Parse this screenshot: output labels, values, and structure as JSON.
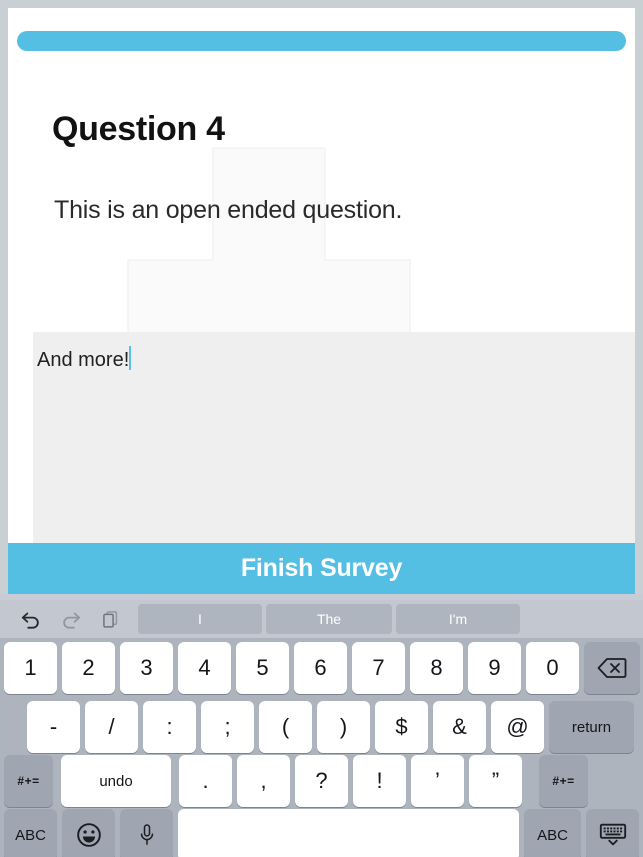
{
  "survey": {
    "progress": {
      "percent": 100,
      "fill_color": "#55bfe3",
      "icon": "progress-bar"
    },
    "question_title": "Question 4",
    "question_text": "This is an open ended question.",
    "answer_value": "And more!",
    "answer_placeholder": "",
    "finish_label": "Finish Survey",
    "finish_color": "#55bfe3"
  },
  "keyboard": {
    "toolbar": {
      "icons": [
        {
          "name": "undo-icon",
          "label": "undo"
        },
        {
          "name": "redo-icon",
          "label": "redo"
        },
        {
          "name": "paste-icon",
          "label": "paste"
        }
      ],
      "suggestions": [
        "I",
        "The",
        "I'm"
      ]
    },
    "rows": {
      "numbers": [
        "1",
        "2",
        "3",
        "4",
        "5",
        "6",
        "7",
        "8",
        "9",
        "0"
      ],
      "backspace_icon": "backspace-icon",
      "symbols": [
        "-",
        "/",
        ":",
        ";",
        "(",
        ")",
        "$",
        "&",
        "@"
      ],
      "return_label": "return",
      "punctuation": [
        ".",
        ",",
        "?",
        "!",
        "’",
        "”"
      ],
      "shift_left_label": "#+=",
      "shift_right_label": "#+=",
      "undo_label": "undo",
      "bottom": {
        "abc_left_label": "ABC",
        "emoji_icon": "emoji-icon",
        "mic_icon": "microphone-icon",
        "space_label": "",
        "abc_right_label": "ABC",
        "hide_keyboard_icon": "hide-keyboard-icon"
      }
    }
  }
}
